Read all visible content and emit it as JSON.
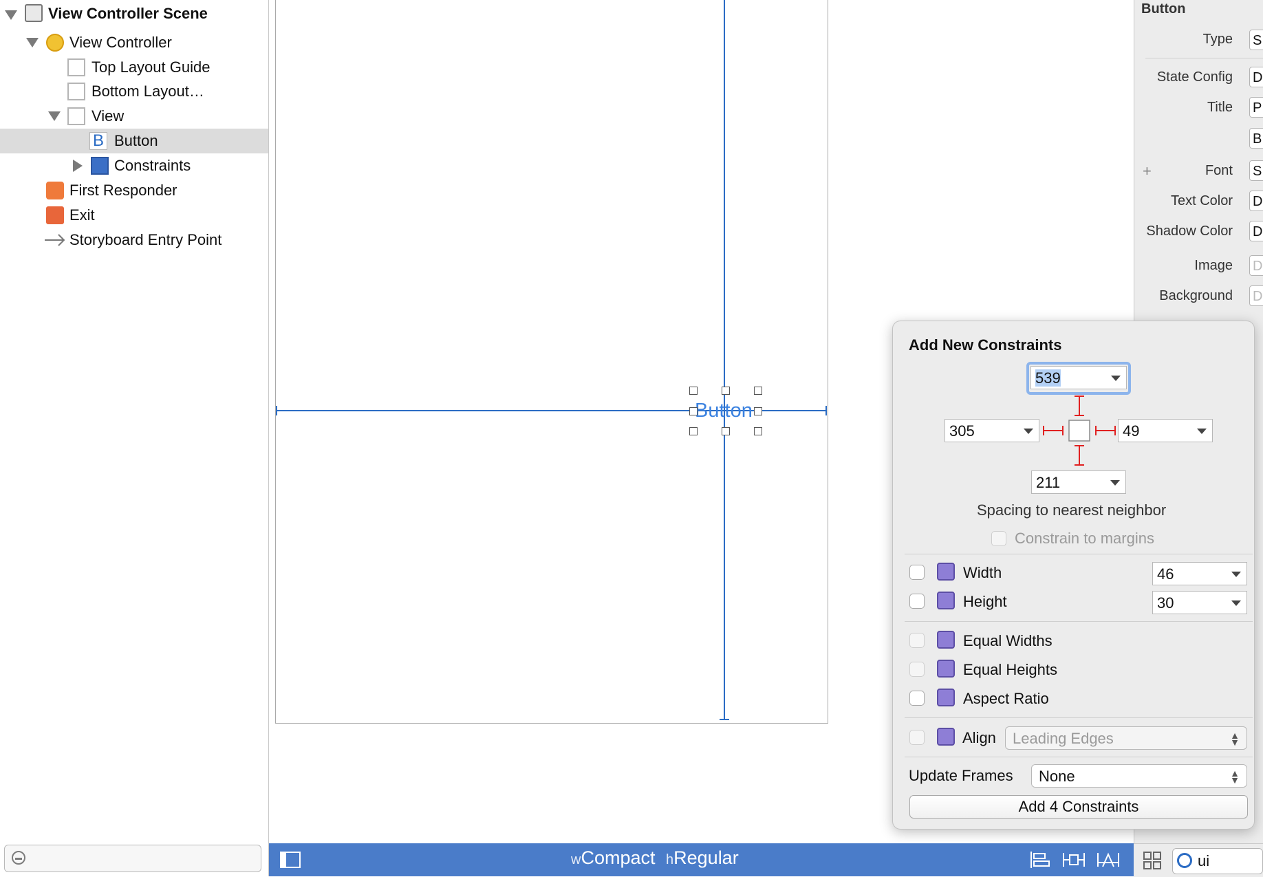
{
  "outline": {
    "items": [
      {
        "label": "View Controller Scene",
        "icon": "scene-icon"
      },
      {
        "label": "View Controller",
        "icon": "view-controller-icon"
      },
      {
        "label": "Top Layout Guide",
        "icon": "layout-guide-icon"
      },
      {
        "label": "Bottom Layout…",
        "icon": "layout-guide-icon"
      },
      {
        "label": "View",
        "icon": "view-icon"
      },
      {
        "label": "Button",
        "icon": "button-icon"
      },
      {
        "label": "Constraints",
        "icon": "constraints-icon"
      },
      {
        "label": "First Responder",
        "icon": "first-responder-icon"
      },
      {
        "label": "Exit",
        "icon": "exit-icon"
      },
      {
        "label": "Storyboard Entry Point",
        "icon": "arrow-icon"
      }
    ],
    "selected": "Button",
    "button_glyph": "B"
  },
  "canvas": {
    "button_label": "Button"
  },
  "bottom_bar": {
    "w_prefix": "w",
    "width_class": "Compact",
    "h_prefix": "h",
    "height_class": "Regular"
  },
  "inspector": {
    "section_title": "Button",
    "labels": {
      "type": "Type",
      "state_config": "State Config",
      "title": "Title",
      "font": "Font",
      "text_color": "Text Color",
      "shadow_color": "Shadow Color",
      "image": "Image",
      "background": "Background"
    },
    "values": {
      "type": "S",
      "state_config": "D",
      "title": "P",
      "title_text": "B",
      "font": "S",
      "text_color": "D",
      "shadow_color": "D",
      "image": "D",
      "background": "D"
    },
    "add_glyph": "+",
    "search_value": "ui"
  },
  "popover": {
    "title": "Add New Constraints",
    "top_value": "539",
    "left_value": "305",
    "right_value": "49",
    "bottom_value": "211",
    "spacing_label": "Spacing to nearest neighbor",
    "margins_label": "Constrain to margins",
    "width_label": "Width",
    "width_value": "46",
    "height_label": "Height",
    "height_value": "30",
    "equal_widths_label": "Equal Widths",
    "equal_heights_label": "Equal Heights",
    "aspect_ratio_label": "Aspect Ratio",
    "align_label": "Align",
    "align_value": "Leading Edges",
    "update_frames_label": "Update Frames",
    "update_frames_value": "None",
    "add_button_label": "Add 4 Constraints"
  },
  "colors": {
    "accent_blue": "#2b6cc4",
    "bottom_bar": "#4a7cc9",
    "constraint_red": "#e02020",
    "selection_gray": "#dcdcdc"
  }
}
